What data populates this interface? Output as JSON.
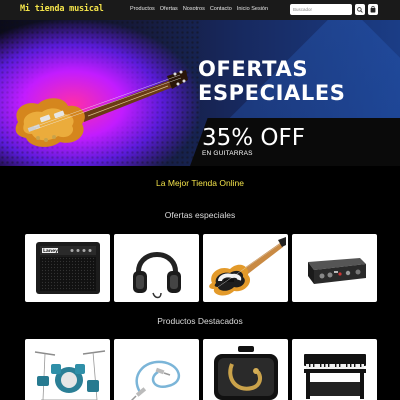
{
  "brand": "Mi tienda musical",
  "nav": [
    {
      "label": "Productos"
    },
    {
      "label": "Ofertas"
    },
    {
      "label": "Nosotros"
    },
    {
      "label": "Contacto"
    },
    {
      "label": "Inicio Sesión"
    }
  ],
  "search": {
    "placeholder": "Buscador",
    "value": ""
  },
  "hero": {
    "title_line1": "OFERTAS",
    "title_line2": "ESPECIALES",
    "discount": "35% OFF",
    "discount_sub": "EN GUITARRAS"
  },
  "tagline": "La Mejor Tienda Online",
  "sections": {
    "offers_title": "Ofertas especiales",
    "featured_title": "Productos Destacados"
  },
  "offers": [
    {
      "icon": "guitar-amplifier",
      "brand_text": "Laney"
    },
    {
      "icon": "headphones"
    },
    {
      "icon": "electric-bass"
    },
    {
      "icon": "audio-interface"
    }
  ],
  "featured": [
    {
      "icon": "drum-kit"
    },
    {
      "icon": "instrument-cable"
    },
    {
      "icon": "saxophone-case"
    },
    {
      "icon": "digital-piano"
    }
  ],
  "colors": {
    "accent": "#f3e34a",
    "background": "#000000",
    "navbar": "#1a1a1a"
  }
}
